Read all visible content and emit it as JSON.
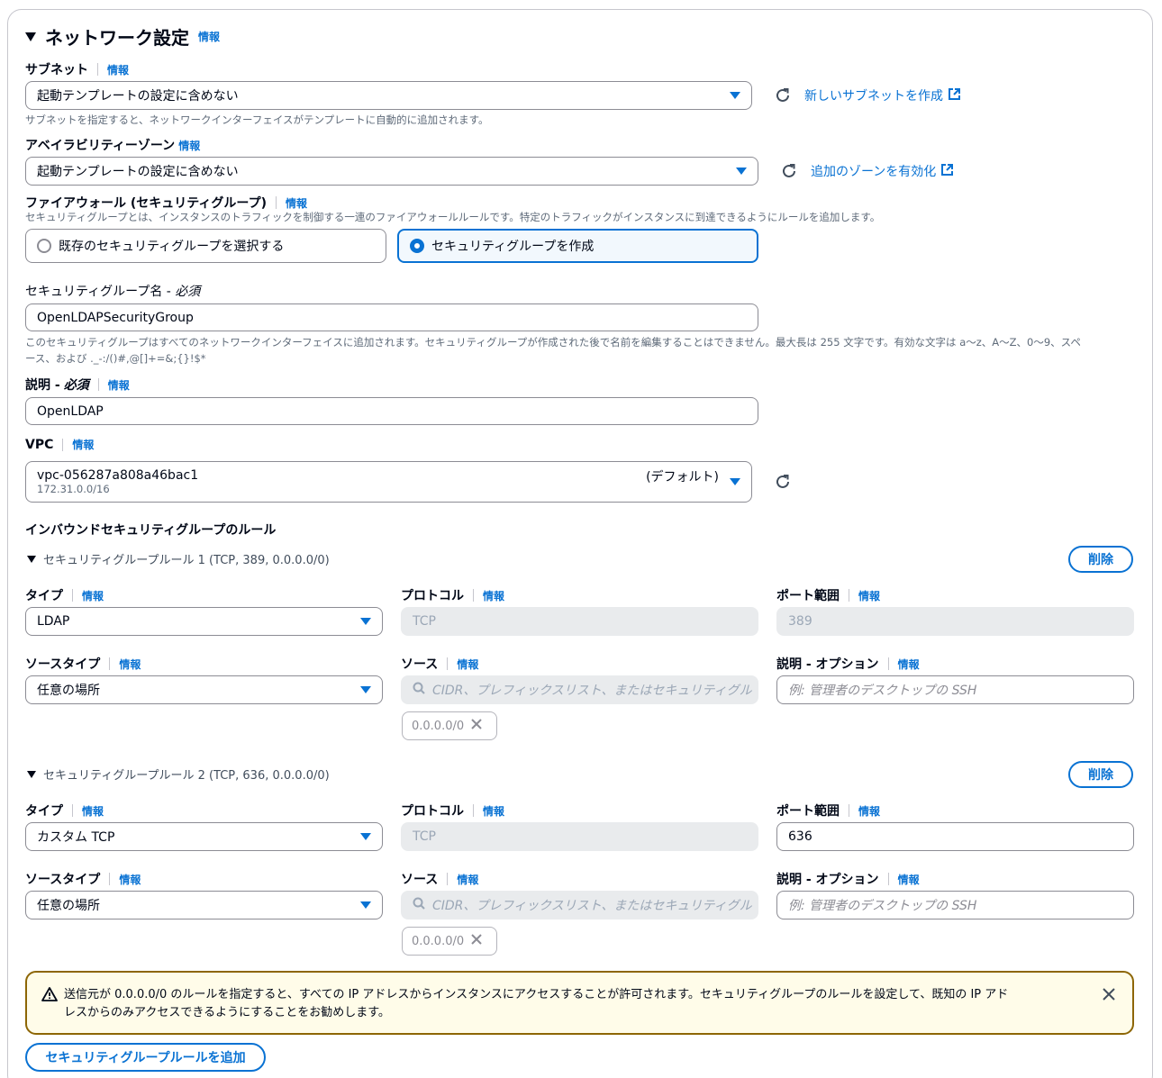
{
  "section": {
    "title": "ネットワーク設定",
    "info": "情報"
  },
  "subnet": {
    "label": "サブネット",
    "info": "情報",
    "value": "起動テンプレートの設定に含めない",
    "link": "新しいサブネットを作成",
    "desc": "サブネットを指定すると、ネットワークインターフェイスがテンプレートに自動的に追加されます。"
  },
  "az": {
    "label": "アベイラビリティーゾーン",
    "info": "情報",
    "value": "起動テンプレートの設定に含めない",
    "link": "追加のゾーンを有効化"
  },
  "firewall": {
    "label": "ファイアウォール (セキュリティグループ)",
    "info": "情報",
    "desc": "セキュリティグループとは、インスタンスのトラフィックを制御する一連のファイアウォールルールです。特定のトラフィックがインスタンスに到達できるようにルールを追加します。",
    "option_existing": "既存のセキュリティグループを選択する",
    "option_create": "セキュリティグループを作成",
    "selected": "create"
  },
  "sg_name": {
    "label": "セキュリティグループ名 - ",
    "required": "必須",
    "value": "OpenLDAPSecurityGroup",
    "desc_line1": "このセキュリティグループはすべてのネットワークインターフェイスに追加されます。セキュリティグループが作成された後で名前を編集することはできません。最大長は 255 文字です。有効な文字は a〜z、A〜Z、0〜9、スペ",
    "desc_line2": "ース、および ._-:/()#,@[]+=&;{}!$*"
  },
  "description": {
    "label": "説明 - ",
    "required": "必須",
    "info": "情報",
    "value": "OpenLDAP"
  },
  "vpc": {
    "label": "VPC",
    "info": "情報",
    "value": "vpc-056287a808a46bac1",
    "cidr": "172.31.0.0/16",
    "tag": "(デフォルト)"
  },
  "inbound": {
    "title": "インバウンドセキュリティグループのルール"
  },
  "rules": [
    {
      "title": "セキュリティグループルール 1 (TCP, 389, 0.0.0.0/0)",
      "delete": "削除",
      "type_label": "タイプ",
      "type_value": "LDAP",
      "protocol_label": "プロトコル",
      "protocol_value": "TCP",
      "port_label": "ポート範囲",
      "port_value": "389",
      "source_type_label": "ソースタイプ",
      "source_type_value": "任意の場所",
      "source_label": "ソース",
      "source_placeholder": "CIDR、プレフィックスリスト、またはセキュリティグル",
      "source_token": "0.0.0.0/0",
      "desc_label": "説明 - オプション",
      "desc_placeholder": "例: 管理者のデスクトップの SSH",
      "info": "情報"
    },
    {
      "title": "セキュリティグループルール 2 (TCP, 636, 0.0.0.0/0)",
      "delete": "削除",
      "type_label": "タイプ",
      "type_value": "カスタム TCP",
      "protocol_label": "プロトコル",
      "protocol_value": "TCP",
      "port_label": "ポート範囲",
      "port_value": "636",
      "source_type_label": "ソースタイプ",
      "source_type_value": "任意の場所",
      "source_label": "ソース",
      "source_placeholder": "CIDR、プレフィックスリスト、またはセキュリティグル",
      "source_token": "0.0.0.0/0",
      "desc_label": "説明 - オプション",
      "desc_placeholder": "例: 管理者のデスクトップの SSH",
      "info": "情報"
    }
  ],
  "warning": {
    "line1": "送信元が 0.0.0.0/0 のルールを指定すると、すべての IP アドレスからインスタンスにアクセスすることが許可されます。セキュリティグループのルールを設定して、既知の IP アド",
    "line2": "レスからのみアクセスできるようにすることをお勧めします。"
  },
  "add_rule_button": "セキュリティグループルールを追加",
  "colors": {
    "accent": "#0972d3",
    "warning_border": "#8d6605",
    "warning_bg": "#fffce9"
  }
}
